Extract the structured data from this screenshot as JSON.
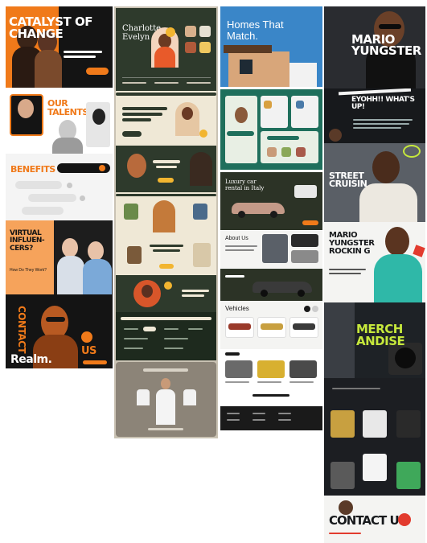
{
  "colors": {
    "realm_orange": "#f07a1a",
    "realm_dark": "#141414",
    "green_dark": "#2e3a2c",
    "cream": "#efe8d6",
    "teal": "#1f6f5c",
    "sky": "#3a86c8",
    "lime": "#c6e83c",
    "mario_dark": "#17191c",
    "accent_red": "#e23b2e"
  },
  "realm": {
    "hero_title": "CATALYST OF CHANGE",
    "talents_title": "OUR TALENTS",
    "benefits_title": "BENEFITS",
    "virtual_title": "VIRTUAL INFLUEN- CERS?",
    "virtual_question": "How Do They Work?",
    "contact_title": "CONTACT",
    "contact_us": "US",
    "brand": "Realm."
  },
  "charlotte": {
    "hero_title": "Charlotte Evelyn"
  },
  "homes": {
    "hero_title": "Homes That Match."
  },
  "cars": {
    "luxury_title": "Luxury car rental in Italy",
    "about_title": "About Us",
    "vehicles_title": "Vehicles"
  },
  "mario": {
    "hero_name": "MARIO YUNGSTER",
    "greeting": "EYOHH!! WHAT'S UP!",
    "cruisin": "STREET CRUISIN",
    "rocking": "MARIO YUNGSTER ROCKIN G",
    "merch": "MERCH ANDISE",
    "contact": "CONTACT US"
  }
}
